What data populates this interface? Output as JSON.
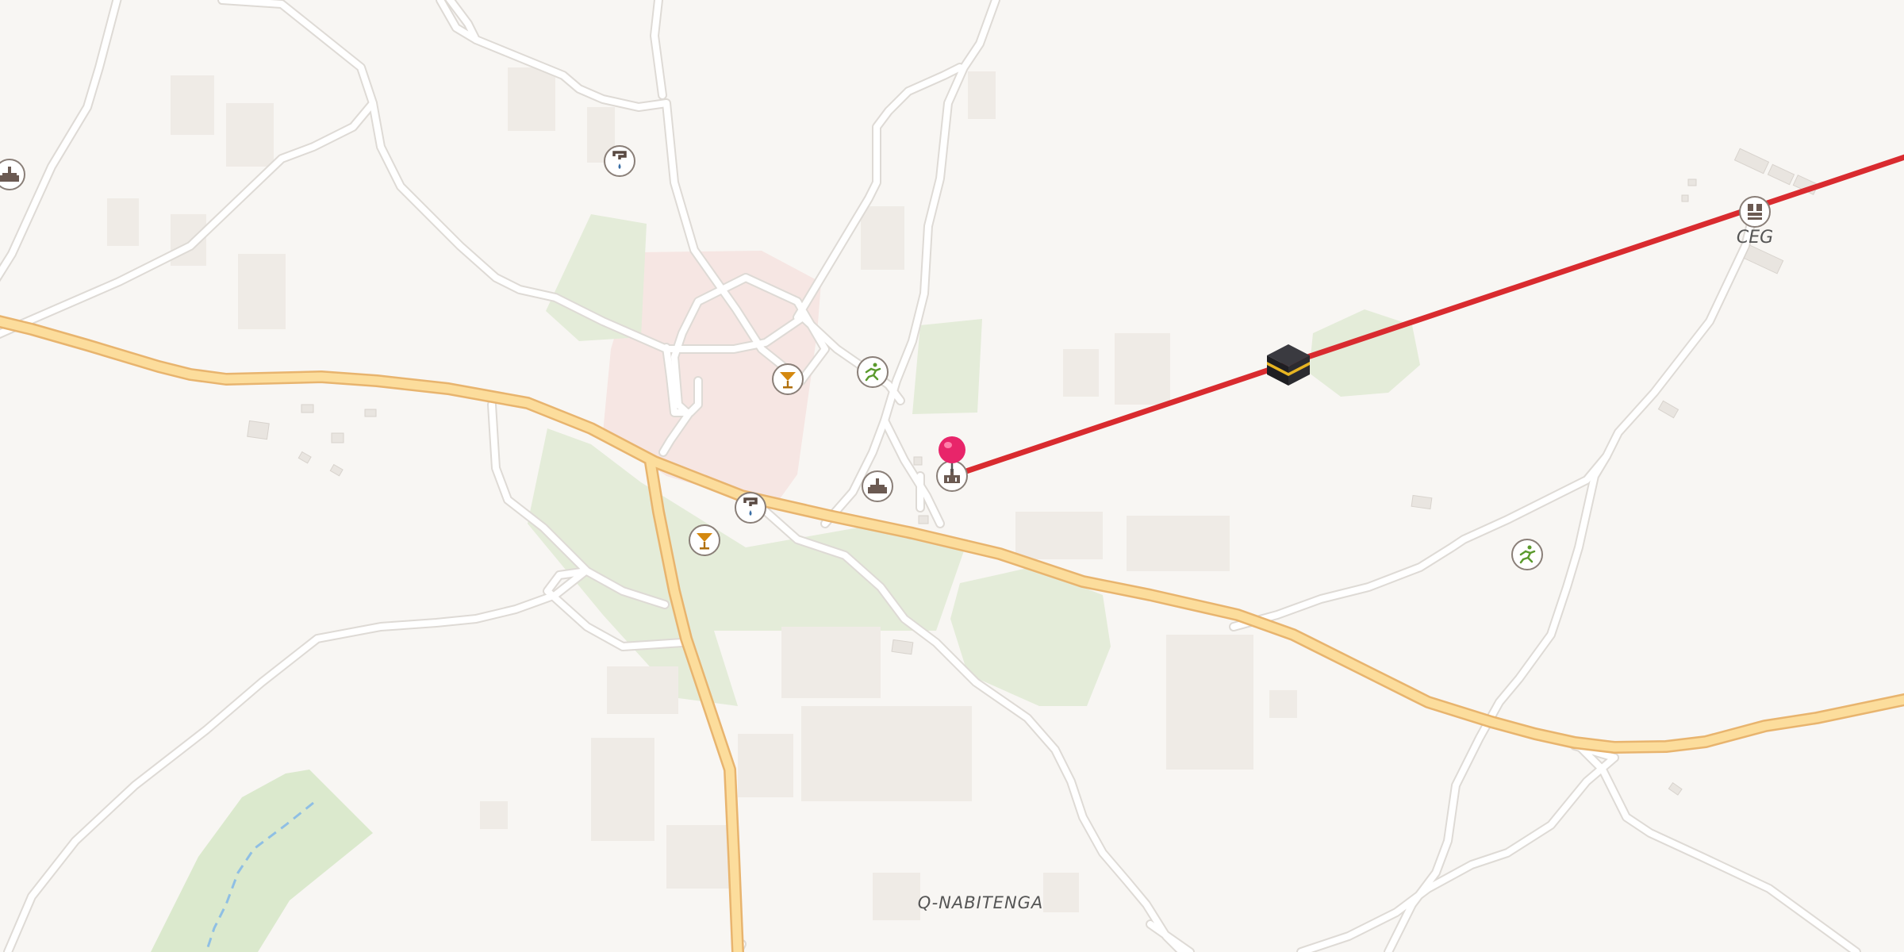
{
  "map": {
    "labels": {
      "locality": "Q-NABITENGA",
      "school": "CEG"
    },
    "colors": {
      "background": "#f8f6f3",
      "primary_road": "#fcdd9c",
      "primary_road_casing": "#e8b46e",
      "minor_road": "#ffffff",
      "minor_road_casing": "#dedad5",
      "park": "#e4ecd9",
      "residential": "#f6e6e3",
      "route_line": "#d92b2f",
      "marker": "#e8256a",
      "waterway": "#8fbfe4"
    },
    "icons": [
      "water-tap-icon",
      "place-of-worship-icon",
      "bar-icon",
      "sports-icon",
      "school-icon",
      "kaaba-icon",
      "location-pin-icon"
    ]
  }
}
